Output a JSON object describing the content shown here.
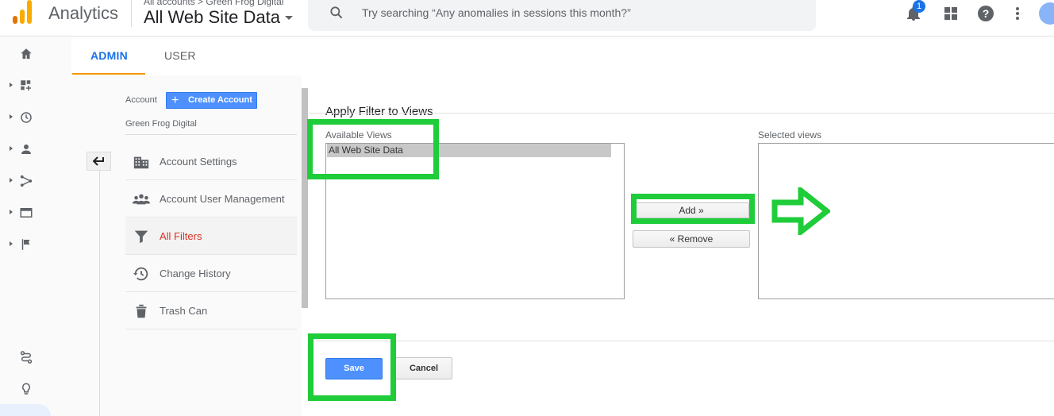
{
  "header": {
    "app_title": "Analytics",
    "breadcrumb": "All accounts > Green Frog Digital",
    "property_name": "All Web Site Data",
    "search_placeholder": "Try searching “Any anomalies in sessions this month?”",
    "notification_count": "1"
  },
  "tabs": [
    {
      "label": "ADMIN",
      "active": true
    },
    {
      "label": "USER",
      "active": false
    }
  ],
  "account": {
    "label": "Account",
    "create_button": "Create Account",
    "name": "Green Frog Digital",
    "menu": [
      {
        "label": "Account Settings",
        "icon": "building-icon"
      },
      {
        "label": "Account User Management",
        "icon": "people-icon"
      },
      {
        "label": "All Filters",
        "icon": "filter-icon",
        "active": true
      },
      {
        "label": "Change History",
        "icon": "history-icon"
      },
      {
        "label": "Trash Can",
        "icon": "trash-icon"
      }
    ]
  },
  "filter_views": {
    "title": "Apply Filter to Views",
    "available_label": "Available Views",
    "available_options": [
      "All Web Site Data"
    ],
    "selected_label": "Selected views",
    "add_button": "Add »",
    "remove_button": "« Remove"
  },
  "actions": {
    "save": "Save",
    "cancel": "Cancel"
  },
  "colors": {
    "accent": "#1a73e8",
    "annotation": "#1fcc3a",
    "active_filter": "#d93025",
    "primary_button": "#4d90fe"
  }
}
